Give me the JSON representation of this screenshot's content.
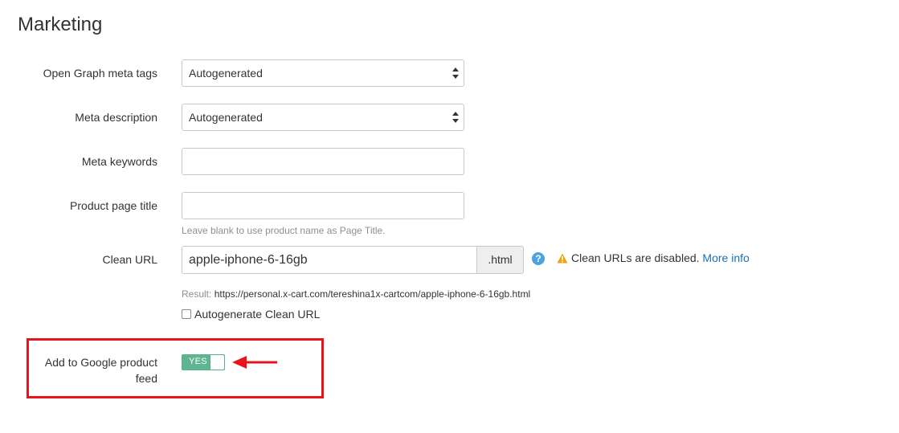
{
  "section": {
    "title": "Marketing"
  },
  "fields": {
    "og_tags": {
      "label": "Open Graph meta tags",
      "value": "Autogenerated"
    },
    "meta_description": {
      "label": "Meta description",
      "value": "Autogenerated"
    },
    "meta_keywords": {
      "label": "Meta keywords",
      "value": ""
    },
    "page_title": {
      "label": "Product page title",
      "value": "",
      "hint": "Leave blank to use product name as Page Title."
    },
    "clean_url": {
      "label": "Clean URL",
      "value": "apple-iphone-6-16gb",
      "suffix": ".html",
      "help_icon": "?",
      "warning": "Clean URLs are disabled.",
      "more_info": "More info",
      "result_prefix": "Result:",
      "result_url": "https://personal.x-cart.com/tereshina1x-cartcom/apple-iphone-6-16gb.html",
      "autogenerate_label": "Autogenerate Clean URL",
      "autogenerate_checked": false
    },
    "google_feed": {
      "label_line1": "Add to Google product",
      "label_line2": "feed",
      "toggle_text": "YES",
      "toggle_on": true
    }
  },
  "colors": {
    "highlight": "#e8141b",
    "toggle_on": "#5fb491",
    "link": "#1a6fb5",
    "help": "#4aa3df",
    "warning": "#f0a30a"
  },
  "icons": {
    "help": "question-circle-icon",
    "warning": "warning-triangle-icon",
    "annotation": "red-arrow-icon"
  }
}
